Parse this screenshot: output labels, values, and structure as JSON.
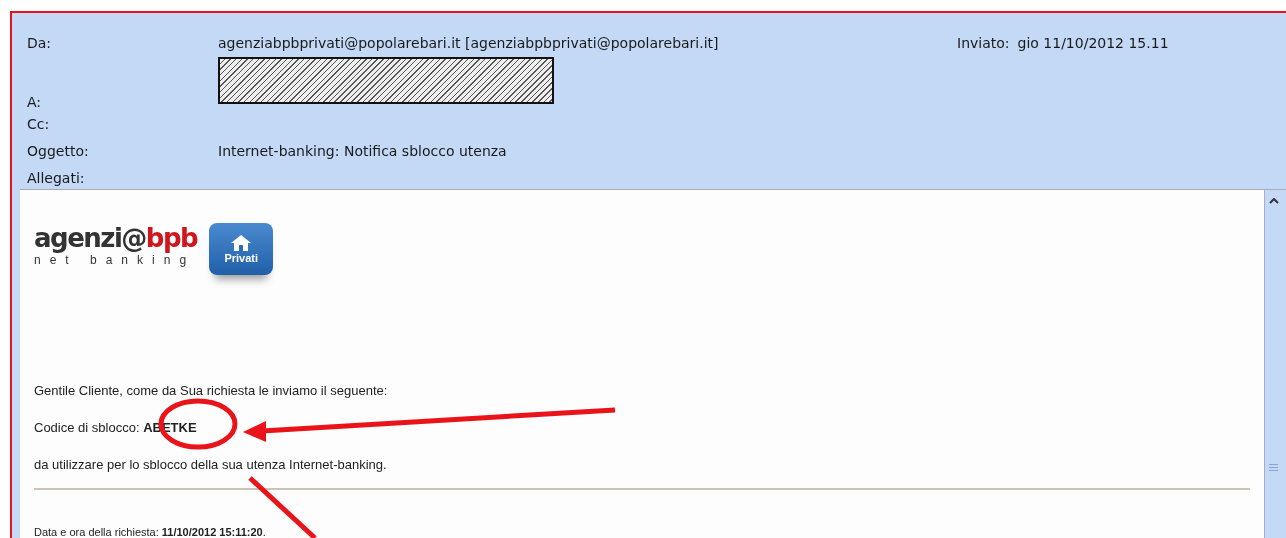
{
  "header": {
    "fields": [
      {
        "label": "Da:",
        "value": "agenziabpbprivati@popolarebari.it [agenziabpbprivati@popolarebari.it]",
        "redacted": false
      },
      {
        "label": "A:",
        "redacted": true
      },
      {
        "label": "Cc:",
        "redacted": false
      },
      {
        "label": "Oggetto:",
        "value": "Internet-banking: Notifica sblocco utenza",
        "redacted": false
      },
      {
        "label": "Allegati:",
        "redacted": false
      }
    ],
    "sent": {
      "label": "Inviato:",
      "value": "gio 11/10/2012 15.11"
    }
  },
  "body": {
    "logo": {
      "name": "agenzi@",
      "accent": "bpb",
      "tagline": "net banking",
      "badge": "Privati"
    },
    "paragraphs": [
      "Gentile Cliente, come da Sua richiesta le inviamo il seguente:",
      "Codice di sblocco: **ABETKE**",
      "da utilizzare per lo sblocco della sua utenza Internet-banking."
    ],
    "footer": "Data e ora della richiesta: **11/10/2012 15:11:20**."
  }
}
